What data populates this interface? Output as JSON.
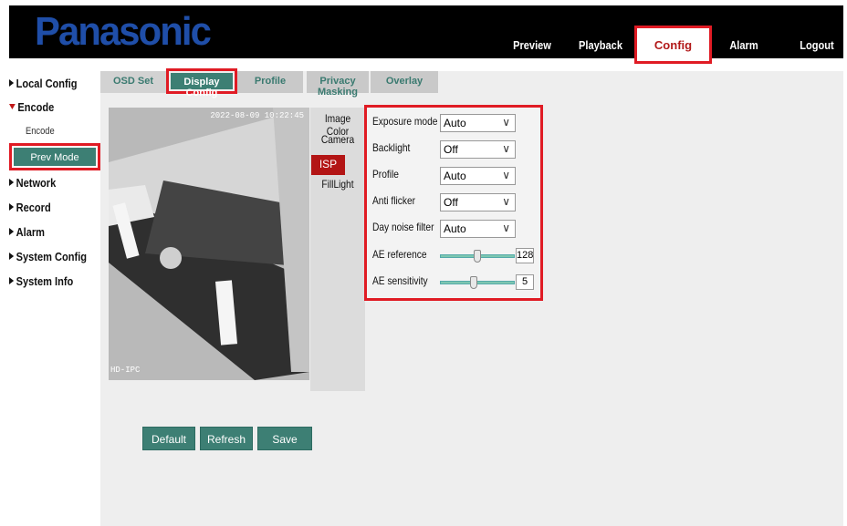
{
  "header": {
    "logo": "Panasonic",
    "nav": [
      "Preview",
      "Playback",
      "Config",
      "Alarm",
      "Logout"
    ],
    "active": "Config"
  },
  "sidebar": {
    "items": [
      {
        "label": "Local Config"
      },
      {
        "label": "Encode"
      },
      {
        "label": "Encode"
      },
      {
        "label": "Prev Mode"
      },
      {
        "label": "Network"
      },
      {
        "label": "Record"
      },
      {
        "label": "Alarm"
      },
      {
        "label": "System Config"
      },
      {
        "label": "System Info"
      }
    ]
  },
  "tabs": [
    "OSD Set",
    "Display Config",
    "Profile",
    "Privacy Masking",
    "Overlay"
  ],
  "video": {
    "timestamp": "2022-08-09 10:22:45",
    "osd": "HD-IPC"
  },
  "submenu": [
    "Image Color",
    "Camera",
    "ISP",
    "FillLight"
  ],
  "settings": {
    "exposure_mode": {
      "label": "Exposure mode",
      "value": "Auto"
    },
    "backlight": {
      "label": "Backlight",
      "value": "Off"
    },
    "profile": {
      "label": "Profile",
      "value": "Auto"
    },
    "anti_flicker": {
      "label": "Anti flicker",
      "value": "Off"
    },
    "day_noise_filter": {
      "label": "Day noise filter",
      "value": "Auto"
    },
    "ae_reference": {
      "label": "AE reference",
      "value": "128"
    },
    "ae_sensitivity": {
      "label": "AE sensitivity",
      "value": "5"
    }
  },
  "buttons": {
    "default": "Default",
    "refresh": "Refresh",
    "save": "Save"
  },
  "icons": {
    "dropdown": "chevron-down-icon",
    "expand": "triangle-right-icon",
    "collapse": "triangle-down-icon"
  },
  "colors": {
    "accent": "#3d7f74",
    "highlight": "#e01b24",
    "brand": "#1f4ea8",
    "active_sub": "#b31515"
  }
}
